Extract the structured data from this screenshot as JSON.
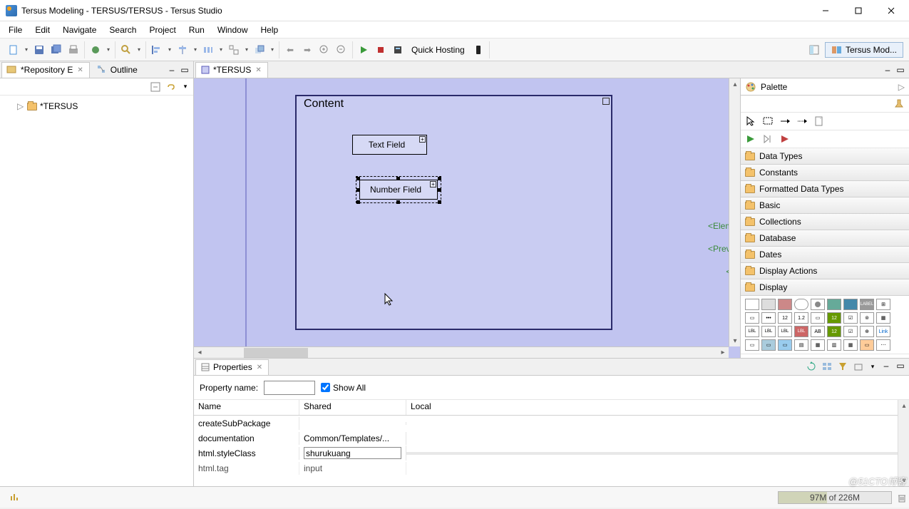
{
  "title": "Tersus Modeling - TERSUS/TERSUS - Tersus Studio",
  "menu": [
    "File",
    "Edit",
    "Navigate",
    "Search",
    "Project",
    "Run",
    "Window",
    "Help"
  ],
  "toolbar": {
    "quick_hosting": "Quick Hosting",
    "perspective": "Tersus Mod..."
  },
  "left": {
    "tabs": {
      "repo": "*Repository E",
      "outline": "Outline"
    },
    "tree_root": "*TERSUS"
  },
  "editor": {
    "tab": "*TERSUS",
    "content_label": "Content",
    "text_field": "Text Field",
    "number_field": "Number Field",
    "side_labels": [
      "<Eleme",
      "<Previo",
      "<N"
    ]
  },
  "palette": {
    "title": "Palette",
    "drawers": [
      "Data Types",
      "Constants",
      "Formatted Data Types",
      "Basic",
      "Collections",
      "Database",
      "Dates",
      "Display Actions",
      "Display"
    ]
  },
  "properties": {
    "tab": "Properties",
    "filter_label": "Property name:",
    "filter_value": "",
    "show_all": "Show All",
    "columns": [
      "Name",
      "Shared",
      "Local"
    ],
    "rows": [
      {
        "name": "createSubPackage",
        "shared": "",
        "local": ""
      },
      {
        "name": "documentation",
        "shared": "Common/Templates/...",
        "local": ""
      },
      {
        "name": "html.styleClass",
        "shared": "shurukuang",
        "local": "",
        "editing": true
      },
      {
        "name": "html.tag",
        "shared": "input",
        "local": ""
      }
    ]
  },
  "status": {
    "memory": "97M of 226M"
  },
  "watermark": "@51CTO博客"
}
